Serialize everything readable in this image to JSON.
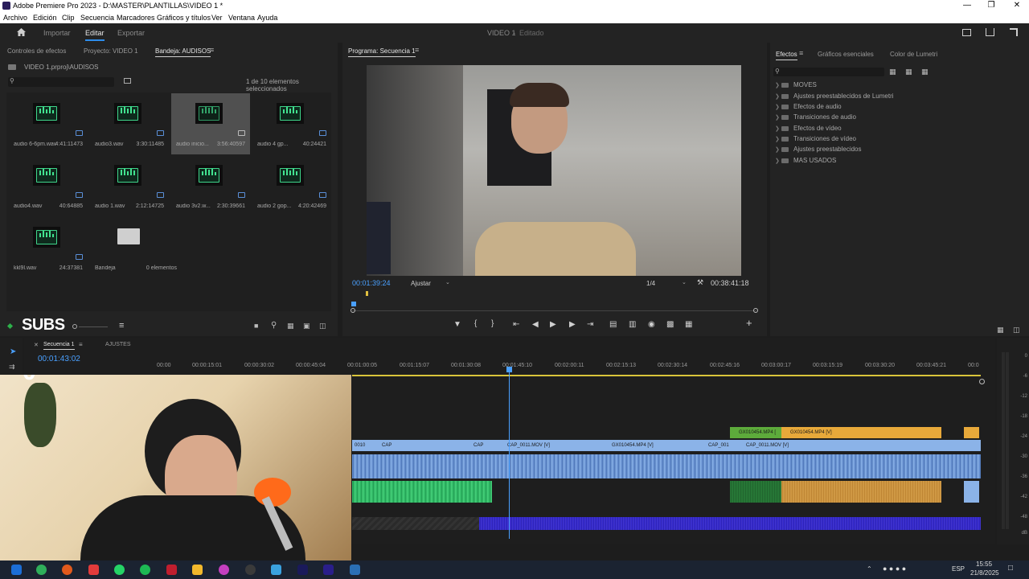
{
  "window": {
    "title": "Adobe Premiere Pro 2023 - D:\\MASTER\\PLANTILLAS\\VIDEO 1 *"
  },
  "menu": [
    "Archivo",
    "Edición",
    "Clip",
    "Secuencia",
    "Marcadores",
    "Gráficos y títulos",
    "Ver",
    "Ventana",
    "Ayuda"
  ],
  "workspace": {
    "tabs": [
      "Importar",
      "Editar",
      "Exportar"
    ],
    "active": "Editar",
    "project": "VIDEO 1",
    "status": "Editado"
  },
  "left_panel": {
    "tabs": [
      "Controles de efectos",
      "Proyecto: VIDEO 1",
      "Bandeja: AUDISOS"
    ],
    "path": "VIDEO 1.prproj\\AUDISOS",
    "selection_info": "1 de 10 elementos seleccionados",
    "items": [
      {
        "name": "audio 6-6pm.wav",
        "duration": "4:41:11473"
      },
      {
        "name": "audio3.wav",
        "duration": "3:30:11485"
      },
      {
        "name": "audio inicio...",
        "duration": "3:56:40597"
      },
      {
        "name": "audio 4 gp...",
        "duration": "40:24421"
      },
      {
        "name": "audio4.wav",
        "duration": "40:64885"
      },
      {
        "name": "audio 1.wav",
        "duration": "2:12:14725"
      },
      {
        "name": "audio 3v2.w...",
        "duration": "2:30:39661"
      },
      {
        "name": "audio 2 gop...",
        "duration": "4:20:42469"
      },
      {
        "name": "kkl9l.wav",
        "duration": "24:37381"
      },
      {
        "name": "Bandeja",
        "duration": "0 elementos"
      }
    ]
  },
  "program": {
    "tab": "Programa: Secuencia 1",
    "timecode": "00:01:39:24",
    "fit": "Ajustar",
    "quality": "1/4",
    "duration": "00:38:41:18"
  },
  "effects": {
    "tabs": [
      "Efectos",
      "Gráficos esenciales",
      "Color de Lumetri"
    ],
    "items": [
      "MOVES",
      "Ajustes preestablecidos de Lumetri",
      "Efectos de audio",
      "Transiciones de audio",
      "Efectos de vídeo",
      "Transiciones de vídeo",
      "Ajustes preestablecidos",
      "MAS USADOS"
    ]
  },
  "overlay": {
    "label": "SUBS",
    "counter": "0"
  },
  "timeline": {
    "tabs": [
      "Secuencia 1",
      "AJUSTES"
    ],
    "timecode": "00:01:43:02",
    "ruler": [
      "00:00",
      "00:00:15:01",
      "00:00:30:02",
      "00:00:45:04",
      "00:01:00:05",
      "00:01:15:07",
      "00:01:30:08",
      "00:01:45:10",
      "00:02:00:11",
      "00:02:15:13",
      "00:02:30:14",
      "00:02:45:16",
      "00:03:00:17",
      "00:03:15:19",
      "00:03:30:20",
      "00:03:45:21",
      "00:0"
    ],
    "clips_v2": [
      "GX010454.MP4 [",
      "GX010454.MP4 [V]"
    ],
    "clips_v1": [
      "0010",
      "CAP",
      "CAP",
      "CAP_0011.MOV [V]",
      "GX010454.MP4 [V]",
      "CAP_001",
      "CAP_0011.MOV [V]"
    ],
    "db_scale": [
      "0",
      "-6",
      "-12",
      "-18",
      "-24",
      "-30",
      "-36",
      "-42",
      "-48",
      "dB"
    ]
  },
  "taskbar": {
    "lang": "ESP",
    "time": "15:55",
    "date": "21/8/2025"
  }
}
